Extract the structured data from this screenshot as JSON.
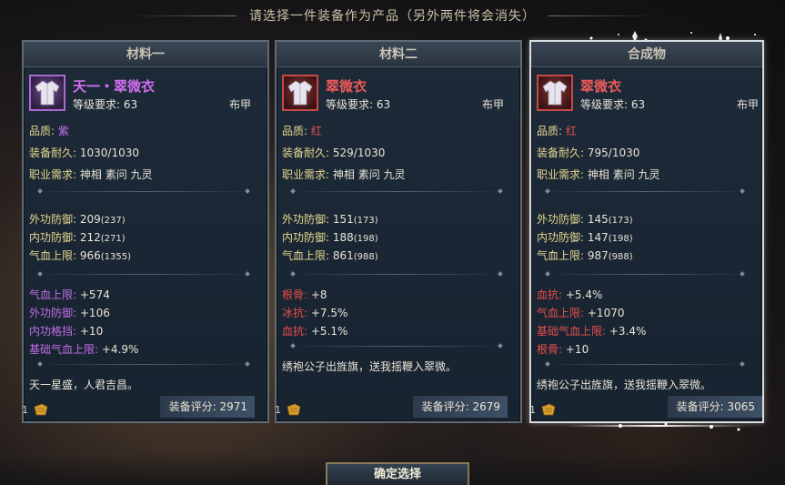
{
  "header": {
    "title": "请选择一件装备作为产品（另外两件将会消失）"
  },
  "panels": [
    {
      "heading": "材料一",
      "name": "天一・翠微衣",
      "level": "等级要求: 63",
      "armor_type": "布甲",
      "quality_label": "品质:",
      "quality_value": "紫",
      "durability_label": "装备耐久:",
      "durability_value": "1030/1030",
      "class_label": "职业需求:",
      "class_value": "神相 素问 九灵",
      "stats": [
        {
          "label": "外功防御:",
          "value": "209",
          "extra": "(237)"
        },
        {
          "label": "内功防御:",
          "value": "212",
          "extra": "(271)"
        },
        {
          "label": "气血上限:",
          "value": "966",
          "extra": "(1355)"
        }
      ],
      "bonuses": [
        {
          "label": "气血上限:",
          "value": "+574"
        },
        {
          "label": "外功防御:",
          "value": "+106"
        },
        {
          "label": "内功格挡:",
          "value": "+10"
        },
        {
          "label": "基础气血上限:",
          "value": "+4.9%"
        }
      ],
      "description": "天一星盛，人君吉昌。",
      "count": "1",
      "score": "装备评分: 2971"
    },
    {
      "heading": "材料二",
      "name": "翠微衣",
      "level": "等级要求: 63",
      "armor_type": "布甲",
      "quality_label": "品质:",
      "quality_value": "红",
      "durability_label": "装备耐久:",
      "durability_value": "529/1030",
      "class_label": "职业需求:",
      "class_value": "神相 素问 九灵",
      "stats": [
        {
          "label": "外功防御:",
          "value": "151",
          "extra": "(173)"
        },
        {
          "label": "内功防御:",
          "value": "188",
          "extra": "(198)"
        },
        {
          "label": "气血上限:",
          "value": "861",
          "extra": "(988)"
        }
      ],
      "bonuses": [
        {
          "label": "根骨:",
          "value": "+8"
        },
        {
          "label": "冰抗:",
          "value": "+7.5%"
        },
        {
          "label": "血抗:",
          "value": "+5.1%"
        }
      ],
      "description": "绣袍公子出旌旗，送我摇鞭入翠微。",
      "count": "1",
      "score": "装备评分: 2679"
    },
    {
      "heading": "合成物",
      "name": "翠微衣",
      "level": "等级要求: 63",
      "armor_type": "布甲",
      "quality_label": "品质:",
      "quality_value": "红",
      "durability_label": "装备耐久:",
      "durability_value": "795/1030",
      "class_label": "职业需求:",
      "class_value": "神相 素问 九灵",
      "stats": [
        {
          "label": "外功防御:",
          "value": "145",
          "extra": "(173)"
        },
        {
          "label": "内功防御:",
          "value": "147",
          "extra": "(198)"
        },
        {
          "label": "气血上限:",
          "value": "987",
          "extra": "(988)"
        }
      ],
      "bonuses": [
        {
          "label": "血抗:",
          "value": "+5.4%"
        },
        {
          "label": "气血上限:",
          "value": "+1070"
        },
        {
          "label": "基础气血上限:",
          "value": "+3.4%"
        },
        {
          "label": "根骨:",
          "value": "+10"
        }
      ],
      "description": "绣袍公子出旌旗，送我摇鞭入翠微。",
      "count": "1",
      "score": "装备评分: 3065"
    }
  ],
  "confirm_button": "确定选择",
  "colors": {
    "purple": "#c474f0",
    "red": "#e85050",
    "gold": "#e6d890"
  }
}
